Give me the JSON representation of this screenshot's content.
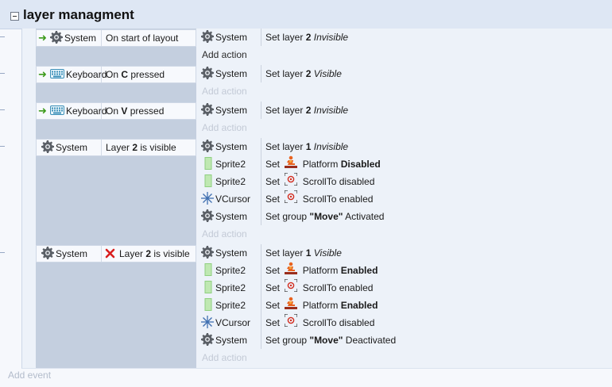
{
  "group": {
    "title": "layer managment"
  },
  "events": [
    {
      "condition": {
        "object": "System",
        "icon": "gear-icon",
        "trigger": true,
        "text": "On start of layout"
      },
      "actions": [
        {
          "object": "System",
          "icon": "gear-icon",
          "pre": "Set layer ",
          "bold": "2",
          "post": " ",
          "italic": "Invisible"
        }
      ],
      "add_action": "Add action"
    },
    {
      "condition": {
        "object": "Keyboard",
        "icon": "keyboard-icon",
        "trigger": true,
        "pre": "On ",
        "bold": "C",
        "post": " pressed"
      },
      "actions": [
        {
          "object": "System",
          "icon": "gear-icon",
          "pre": "Set layer ",
          "bold": "2",
          "post": " ",
          "italic": "Visible"
        }
      ],
      "add_action": "Add action"
    },
    {
      "condition": {
        "object": "Keyboard",
        "icon": "keyboard-icon",
        "trigger": true,
        "pre": "On ",
        "bold": "V",
        "post": " pressed"
      },
      "actions": [
        {
          "object": "System",
          "icon": "gear-icon",
          "pre": "Set layer ",
          "bold": "2",
          "post": " ",
          "italic": "Invisible"
        }
      ],
      "add_action": "Add action"
    },
    {
      "condition": {
        "object": "System",
        "icon": "gear-icon",
        "pre": "Layer ",
        "bold": "2",
        "post": " is visible"
      },
      "actions": [
        {
          "object": "System",
          "icon": "gear-icon",
          "pre": "Set layer ",
          "bold": "1",
          "post": " ",
          "italic": "Invisible"
        },
        {
          "object": "Sprite2",
          "icon": "sprite-icon",
          "pre": "Set ",
          "behavior_icon": "platform-icon",
          "mid": " Platform ",
          "bold": "Disabled"
        },
        {
          "object": "Sprite2",
          "icon": "sprite-icon",
          "pre": "Set ",
          "behavior_icon": "scrollto-icon",
          "mid": " ScrollTo disabled"
        },
        {
          "object": "VCursor",
          "icon": "cursor-icon",
          "pre": "Set ",
          "behavior_icon": "scrollto-icon",
          "mid": " ScrollTo enabled"
        },
        {
          "object": "System",
          "icon": "gear-icon",
          "pre": "Set group ",
          "bold": "\"Move\"",
          "post": " Activated"
        }
      ],
      "add_action": "Add action"
    },
    {
      "condition": {
        "object": "System",
        "icon": "gear-icon",
        "inverted": true,
        "pre": "Layer ",
        "bold": "2",
        "post": " is visible"
      },
      "actions": [
        {
          "object": "System",
          "icon": "gear-icon",
          "pre": "Set layer ",
          "bold": "1",
          "post": " ",
          "italic": "Visible"
        },
        {
          "object": "Sprite2",
          "icon": "sprite-icon",
          "pre": "Set ",
          "behavior_icon": "platform-icon",
          "mid": " Platform ",
          "bold": "Enabled"
        },
        {
          "object": "Sprite2",
          "icon": "sprite-icon",
          "pre": "Set ",
          "behavior_icon": "scrollto-icon",
          "mid": " ScrollTo enabled"
        },
        {
          "object": "Sprite2",
          "icon": "sprite-icon",
          "pre": "Set ",
          "behavior_icon": "platform-icon",
          "mid": " Platform ",
          "bold": "Enabled"
        },
        {
          "object": "VCursor",
          "icon": "cursor-icon",
          "pre": "Set ",
          "behavior_icon": "scrollto-icon",
          "mid": " ScrollTo disabled"
        },
        {
          "object": "System",
          "icon": "gear-icon",
          "pre": "Set group ",
          "bold": "\"Move\"",
          "post": " Deactivated"
        }
      ],
      "add_action": "Add action"
    }
  ],
  "add_event": "Add event",
  "colors": {
    "trigger_arrow": "#3d9b1c",
    "invert_x": "#d81e1e",
    "condition_column": "#c4cfdf",
    "event_bg": "#edf2f9",
    "group_header": "#dee7f4"
  }
}
